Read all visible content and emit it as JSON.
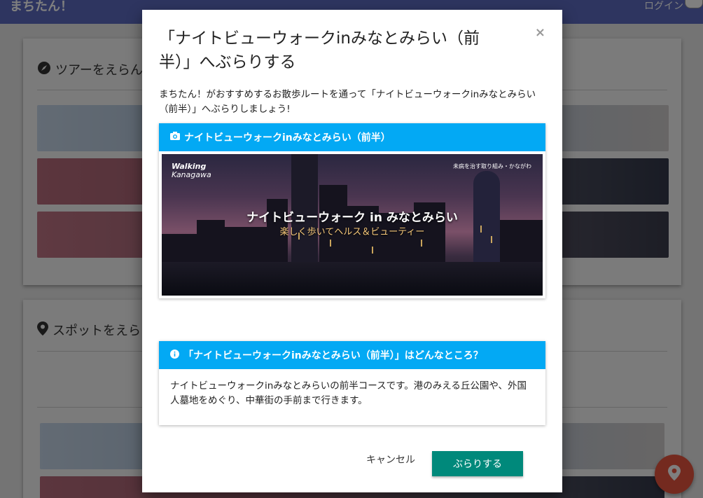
{
  "app": {
    "title": "まちたん！",
    "login_label": "ログイン"
  },
  "tours_card": {
    "heading": "ツアーをえらん",
    "icon": "compass-icon"
  },
  "spots_card": {
    "heading": "スポットをえら",
    "icon": "map-marker-icon"
  },
  "fab": {
    "icon": "map-marker-icon"
  },
  "modal": {
    "title": "「ナイトビューウォークinみなとみらい（前半）」へぶらりする",
    "close_label": "×",
    "intro": "まちたん！がおすすめするお散歩ルートを通って「ナイトビューウォークinみなとみらい（前半）」へぶらりしましょう!",
    "photo_panel": {
      "heading": "ナイトビューウォークinみなとみらい（前半）",
      "icon": "camera-icon",
      "image": {
        "logo_walking": "Walking",
        "logo_kanagawa": "Kanagawa",
        "tagline": "未病を治す取り組み・かながわ",
        "headline": "ナイトビューウォーク in みなとみらい",
        "subline": "楽しく歩いてヘルス＆ビューティー"
      }
    },
    "info_panel": {
      "heading": "「ナイトビューウォークinみなとみらい（前半）」はどんなところ？",
      "icon": "info-icon",
      "body": "ナイトビューウォークinみなとみらいの前半コースです。港のみえる丘公園や、外国人墓地をめぐり、中華街の手前まで行きます。"
    },
    "cancel_label": "キャンセル",
    "confirm_label": "ぶらりする"
  },
  "colors": {
    "app_bar": "#5c6bc0",
    "panel_header": "#03a9f4",
    "confirm_button": "#00897b",
    "fab": "#e8553f"
  }
}
